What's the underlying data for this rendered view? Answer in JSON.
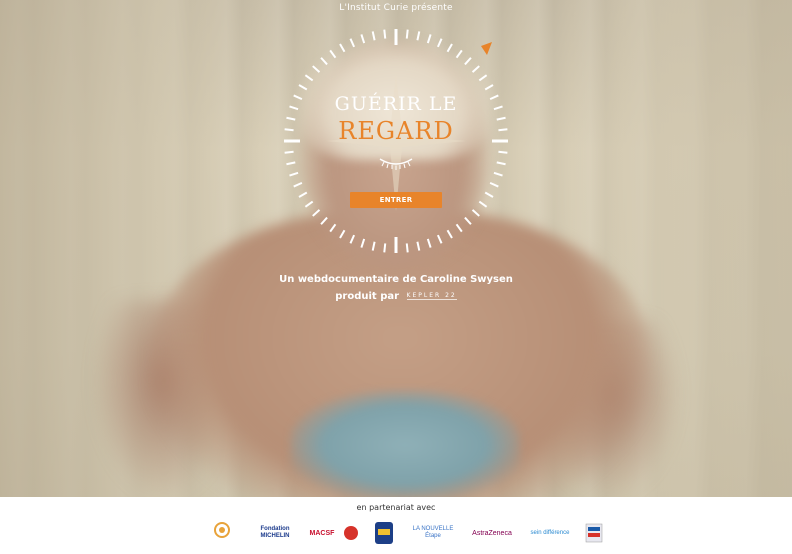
{
  "header": {
    "caption": "L'Institut Curie présente"
  },
  "hero": {
    "title_line1": "GUÉRIR LE",
    "title_line2": "REGARD",
    "enter_label": "ENTRER",
    "subtitle": "Un webdocumentaire de Caroline Swysen",
    "produced_by": "produit par",
    "producer_logo_text": "KEPLER 22"
  },
  "footer": {
    "partners_label": "en partenariat avec",
    "partners": [
      {
        "name": "Institut Curie",
        "text": "institutcurie"
      },
      {
        "name": "Fondation Michelin",
        "text": "Fondation MICHELIN"
      },
      {
        "name": "MACSF",
        "text": "MACSF"
      },
      {
        "name": "Partner 4",
        "text": ""
      },
      {
        "name": "La Nouvelle Étape",
        "text": "LA NOUVELLE Étape"
      },
      {
        "name": "AstraZeneca",
        "text": "AstraZeneca"
      },
      {
        "name": "Un sein différent",
        "text": "sein différence"
      },
      {
        "name": "Partner 8",
        "text": ""
      }
    ]
  },
  "colors": {
    "accent": "#e8842a",
    "white": "#ffffff"
  },
  "icons": {
    "eye": "closed-eye-icon",
    "compass": "compass-star-icon",
    "arrow": "triangle-pointer-icon"
  }
}
